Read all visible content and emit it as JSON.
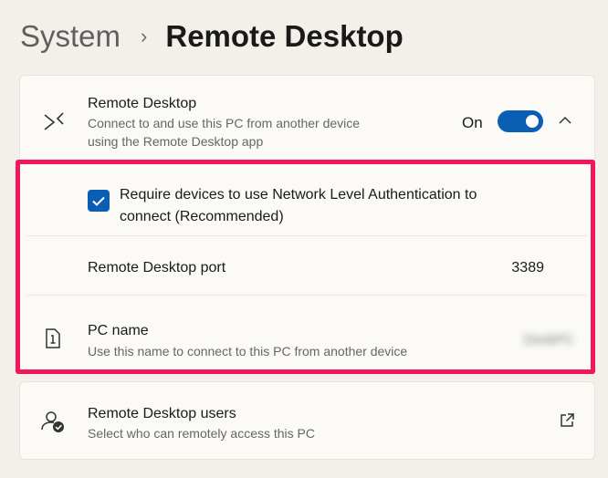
{
  "breadcrumb": {
    "parent": "System",
    "separator": "›",
    "current": "Remote Desktop"
  },
  "remote_desktop": {
    "title": "Remote Desktop",
    "description": "Connect to and use this PC from another device using the Remote Desktop app",
    "toggle_state_label": "On",
    "toggle_on": true,
    "icon": "remote-desktop-icon"
  },
  "nla": {
    "checked": true,
    "label": "Require devices to use Network Level Authentication to connect (Recommended)"
  },
  "port": {
    "label": "Remote Desktop port",
    "value": "3389"
  },
  "pc_name": {
    "title": "PC name",
    "description": "Use this name to connect to this PC from another device",
    "value": "DeskPC",
    "icon": "pc-info-icon"
  },
  "users": {
    "title": "Remote Desktop users",
    "description": "Select who can remotely access this PC",
    "icon": "user-check-icon",
    "action_icon": "open-external-icon"
  },
  "colors": {
    "accent": "#0a5fb4",
    "highlight": "#f2165d",
    "background": "#f3f0ea",
    "card": "#fbfaf7"
  }
}
